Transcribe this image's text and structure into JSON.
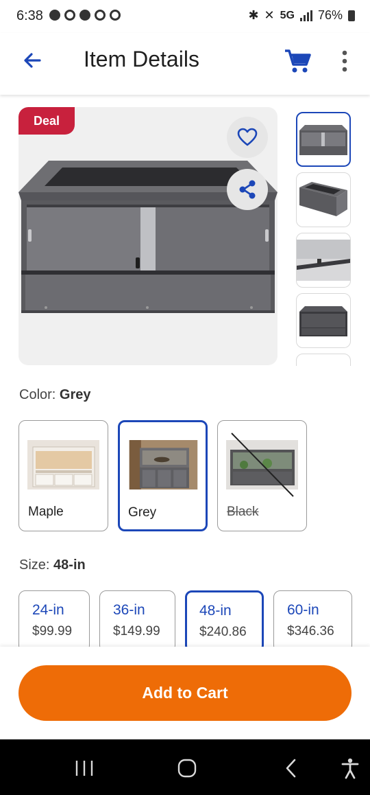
{
  "status_bar": {
    "time": "6:38",
    "network": "5G",
    "battery": "76%"
  },
  "header": {
    "title": "Item Details",
    "back_icon": "arrow-left-icon",
    "cart_icon": "shopping-cart-icon",
    "more_icon": "more-vertical-icon",
    "accent_color": "#1c47b8"
  },
  "gallery": {
    "badge": "Deal",
    "badge_color": "#c8213d",
    "thumbnail_count": 5,
    "selected_thumbnail": 1
  },
  "color_option": {
    "label": "Color:",
    "selected": "Grey",
    "choices": [
      {
        "name": "Maple",
        "state": "available"
      },
      {
        "name": "Grey",
        "state": "selected"
      },
      {
        "name": "Black",
        "state": "unavailable"
      }
    ]
  },
  "size_option": {
    "label": "Size:",
    "selected": "48-in",
    "choices": [
      {
        "size": "24-in",
        "price": "$99.99"
      },
      {
        "size": "36-in",
        "price": "$149.99"
      },
      {
        "size": "48-in",
        "price": "$240.86"
      },
      {
        "size": "60-in",
        "price": "$346.36"
      }
    ]
  },
  "cta": {
    "label": "Add to Cart",
    "color": "#ee6c07"
  },
  "nav_bar": {
    "items": [
      "recent-apps-icon",
      "home-icon",
      "back-icon",
      "accessibility-icon"
    ]
  }
}
